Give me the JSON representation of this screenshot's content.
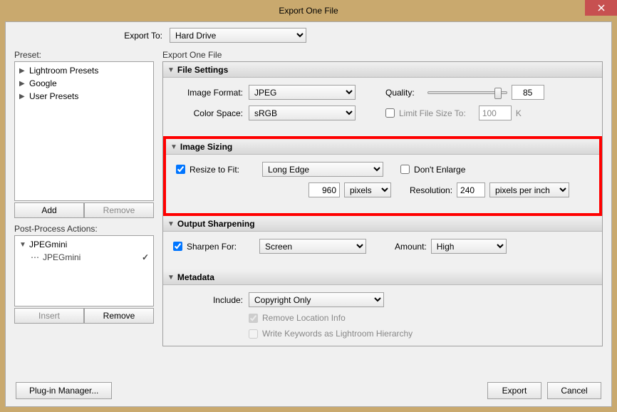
{
  "window": {
    "title": "Export One File"
  },
  "exportTo": {
    "label": "Export To:",
    "value": "Hard Drive"
  },
  "preset": {
    "label": "Preset:",
    "items": [
      "Lightroom Presets",
      "Google",
      "User Presets"
    ],
    "addBtn": "Add",
    "removeBtn": "Remove"
  },
  "postProcess": {
    "label": "Post-Process Actions:",
    "group": "JPEGmini",
    "item": "JPEGmini",
    "insertBtn": "Insert",
    "removeBtn": "Remove"
  },
  "main": {
    "label": "Export One File",
    "fileSettings": {
      "header": "File Settings",
      "imageFormatLabel": "Image Format:",
      "imageFormat": "JPEG",
      "qualityLabel": "Quality:",
      "qualityValue": "85",
      "colorSpaceLabel": "Color Space:",
      "colorSpace": "sRGB",
      "limitLabel": "Limit File Size To:",
      "limitValue": "100",
      "limitUnit": "K"
    },
    "imageSizing": {
      "header": "Image Sizing",
      "resizeLabel": "Resize to Fit:",
      "resizeMode": "Long Edge",
      "dontEnlarge": "Don't Enlarge",
      "sizeValue": "960",
      "sizeUnit": "pixels",
      "resolutionLabel": "Resolution:",
      "resolutionValue": "240",
      "resolutionUnit": "pixels per inch"
    },
    "outputSharpen": {
      "header": "Output Sharpening",
      "sharpenLabel": "Sharpen For:",
      "sharpenFor": "Screen",
      "amountLabel": "Amount:",
      "amount": "High"
    },
    "metadata": {
      "header": "Metadata",
      "includeLabel": "Include:",
      "include": "Copyright Only",
      "removeLocation": "Remove Location Info",
      "writeKeywords": "Write Keywords as Lightroom Hierarchy"
    }
  },
  "footer": {
    "pluginBtn": "Plug-in Manager...",
    "export": "Export",
    "cancel": "Cancel"
  }
}
